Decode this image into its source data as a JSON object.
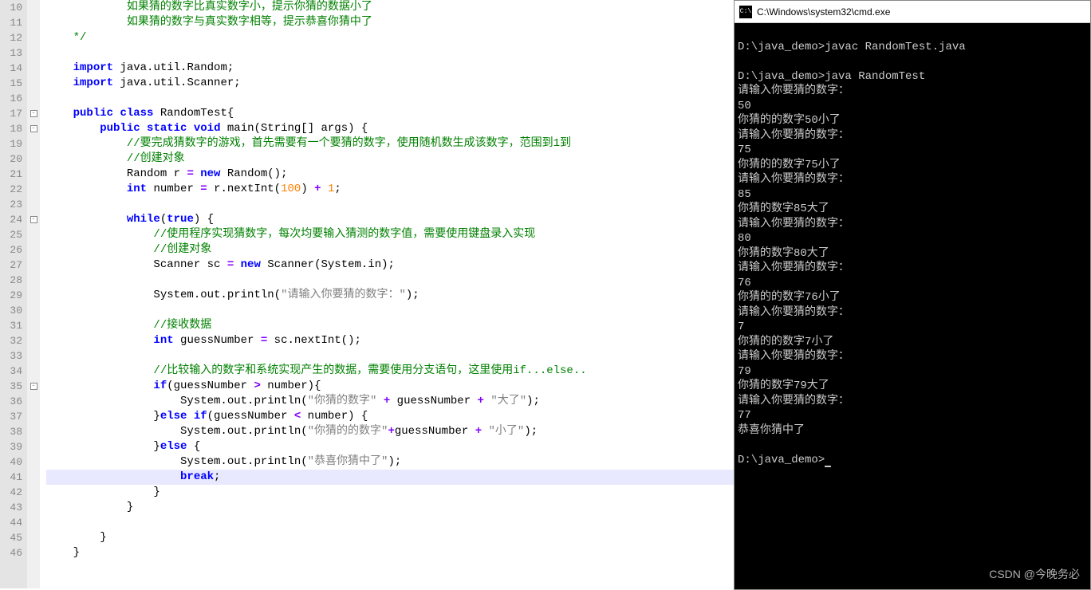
{
  "editor": {
    "lines": [
      {
        "n": 10,
        "html": "            如果猜的数字比真实数字小，提示你猜的数据小了",
        "cls": "cm"
      },
      {
        "n": 11,
        "html": "            如果猜的数字与真实数字相等，提示恭喜你猜中了",
        "cls": "cm"
      },
      {
        "n": 12,
        "html": "    */",
        "cls": "cm"
      },
      {
        "n": 13,
        "html": ""
      },
      {
        "n": 14,
        "html": "    <span class='kw'>import</span> java.util.Random;"
      },
      {
        "n": 15,
        "html": "    <span class='kw'>import</span> java.util.Scanner;"
      },
      {
        "n": 16,
        "html": ""
      },
      {
        "n": 17,
        "fold": "-",
        "html": "    <span class='kw'>public</span> <span class='kw'>class</span> RandomTest{"
      },
      {
        "n": 18,
        "fold": "-",
        "html": "        <span class='kw'>public</span> <span class='kw'>static</span> <span class='kw'>void</span> main(String[] args) {"
      },
      {
        "n": 19,
        "html": "            <span class='cm'>//要完成猜数字的游戏，首先需要有一个要猜的数字，使用随机数生成该数字，范围到1到</span>"
      },
      {
        "n": 20,
        "html": "            <span class='cm'>//创建对象</span>"
      },
      {
        "n": 21,
        "html": "            Random r <span class='op'>=</span> <span class='kw'>new</span> Random();"
      },
      {
        "n": 22,
        "html": "            <span class='kw'>int</span> number <span class='op'>=</span> r.nextInt(<span class='num'>100</span>) <span class='op'>+</span> <span class='num'>1</span>;"
      },
      {
        "n": 23,
        "html": ""
      },
      {
        "n": 24,
        "fold": "-",
        "html": "            <span class='kw'>while</span>(<span class='kw'>true</span>) {"
      },
      {
        "n": 25,
        "html": "                <span class='cm'>//使用程序实现猜数字，每次均要输入猜测的数字值，需要使用键盘录入实现</span>"
      },
      {
        "n": 26,
        "html": "                <span class='cm'>//创建对象</span>"
      },
      {
        "n": 27,
        "html": "                Scanner sc <span class='op'>=</span> <span class='kw'>new</span> Scanner(System.in);"
      },
      {
        "n": 28,
        "html": ""
      },
      {
        "n": 29,
        "html": "                System.out.println(<span class='str'>\"请输入你要猜的数字：\"</span>);"
      },
      {
        "n": 30,
        "html": ""
      },
      {
        "n": 31,
        "html": "                <span class='cm'>//接收数据</span>"
      },
      {
        "n": 32,
        "html": "                <span class='kw'>int</span> guessNumber <span class='op'>=</span> sc.nextInt();"
      },
      {
        "n": 33,
        "html": ""
      },
      {
        "n": 34,
        "html": "                <span class='cm'>//比较输入的数字和系统实现产生的数据，需要使用分支语句，这里使用if...else..</span>"
      },
      {
        "n": 35,
        "fold": "-",
        "html": "                <span class='kw'>if</span>(guessNumber <span class='op'>&gt;</span> number){"
      },
      {
        "n": 36,
        "html": "                    System.out.println(<span class='str'>\"你猜的数字\"</span> <span class='op'>+</span> guessNumber <span class='op'>+</span> <span class='str'>\"大了\"</span>);"
      },
      {
        "n": 37,
        "html": "                }<span class='kw'>else</span> <span class='kw'>if</span>(guessNumber <span class='op'>&lt;</span> number) {"
      },
      {
        "n": 38,
        "html": "                    System.out.println(<span class='str'>\"你猜的的数字\"</span><span class='op'>+</span>guessNumber <span class='op'>+</span> <span class='str'>\"小了\"</span>);"
      },
      {
        "n": 39,
        "html": "                }<span class='kw'>else</span> {"
      },
      {
        "n": 40,
        "html": "                    System.out.println(<span class='str'>\"恭喜你猜中了\"</span>);"
      },
      {
        "n": 41,
        "hl": true,
        "html": "                    <span class='kw'>break</span>;"
      },
      {
        "n": 42,
        "html": "                }"
      },
      {
        "n": 43,
        "html": "            }"
      },
      {
        "n": 44,
        "html": ""
      },
      {
        "n": 45,
        "html": "        }"
      },
      {
        "n": 46,
        "html": "    }"
      }
    ]
  },
  "cmd": {
    "title": "C:\\Windows\\system32\\cmd.exe",
    "lines": [
      "",
      "D:\\java_demo>javac RandomTest.java",
      "",
      "D:\\java_demo>java RandomTest",
      "请输入你要猜的数字：",
      "50",
      "你猜的的数字50小了",
      "请输入你要猜的数字：",
      "75",
      "你猜的的数字75小了",
      "请输入你要猜的数字：",
      "85",
      "你猜的数字85大了",
      "请输入你要猜的数字：",
      "80",
      "你猜的数字80大了",
      "请输入你要猜的数字：",
      "76",
      "你猜的的数字76小了",
      "请输入你要猜的数字：",
      "7",
      "你猜的的数字7小了",
      "请输入你要猜的数字：",
      "79",
      "你猜的数字79大了",
      "请输入你要猜的数字：",
      "77",
      "恭喜你猜中了",
      "",
      "D:\\java_demo>"
    ]
  },
  "watermark": "CSDN @今晚务必"
}
